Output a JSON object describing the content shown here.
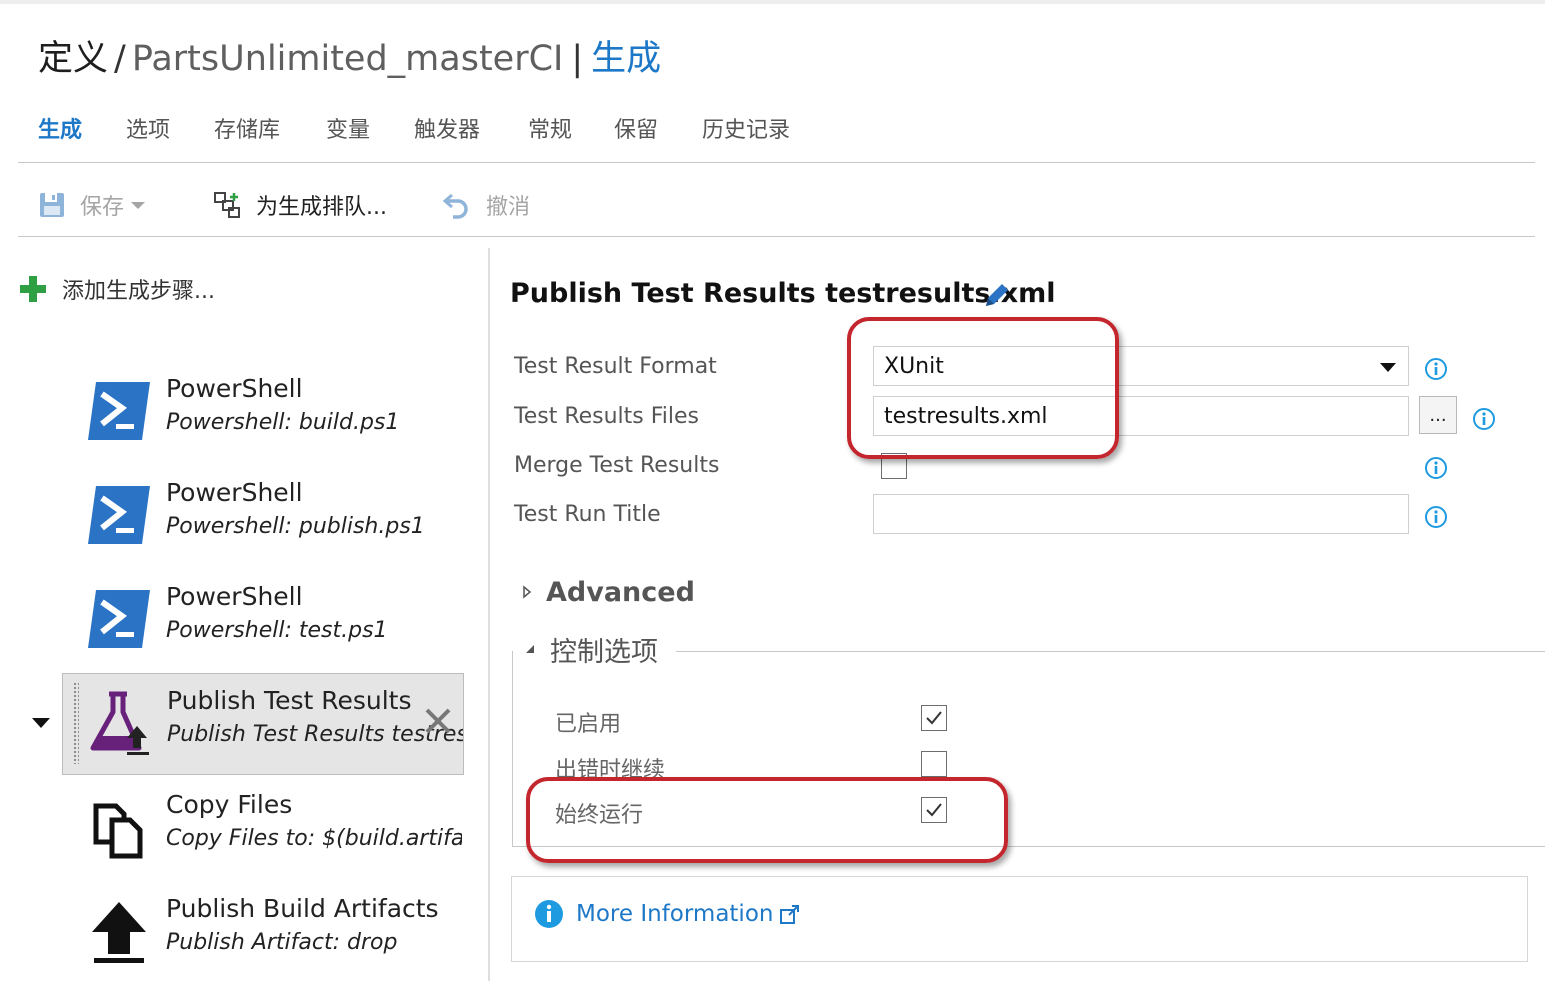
{
  "title": {
    "definition": "定义",
    "separator": "/",
    "definition_name": "PartsUnlimited_masterCI",
    "bar": "|",
    "current": "生成"
  },
  "tabs": [
    {
      "label": "生成",
      "active": true
    },
    {
      "label": "选项"
    },
    {
      "label": "存储库"
    },
    {
      "label": "变量"
    },
    {
      "label": "触发器"
    },
    {
      "label": "常规"
    },
    {
      "label": "保留"
    },
    {
      "label": "历史记录"
    }
  ],
  "toolbar": {
    "save": "保存",
    "queue": "为生成排队...",
    "undo": "撤消"
  },
  "steps_panel": {
    "add_step": "添加生成步骤...",
    "steps": [
      {
        "name": "PowerShell",
        "detail": "Powershell: build.ps1",
        "icon": "powershell-icon"
      },
      {
        "name": "PowerShell",
        "detail": "Powershell: publish.ps1",
        "icon": "powershell-icon"
      },
      {
        "name": "PowerShell",
        "detail": "Powershell: test.ps1",
        "icon": "powershell-icon"
      },
      {
        "name": "Publish Test Results",
        "detail": "Publish Test Results testresul",
        "icon": "flask-upload-icon",
        "selected": true
      },
      {
        "name": "Copy Files",
        "detail": "Copy Files to: $(build.artifact",
        "icon": "copy-files-icon"
      },
      {
        "name": "Publish Build Artifacts",
        "detail": "Publish Artifact: drop",
        "icon": "upload-arrow-icon"
      }
    ]
  },
  "task": {
    "title": "Publish Test Results testresults.xml",
    "fields": {
      "format_label": "Test Result Format",
      "format_value": "XUnit",
      "files_label": "Test Results Files",
      "files_value": "testresults.xml",
      "browse_label": "...",
      "merge_label": "Merge Test Results",
      "merge_checked": false,
      "run_title_label": "Test Run Title",
      "run_title_value": ""
    },
    "advanced_label": "Advanced",
    "control_options": {
      "label": "控制选项",
      "enabled_label": "已启用",
      "enabled_checked": true,
      "continue_on_error_label": "出错时继续",
      "continue_on_error_checked": false,
      "always_run_label": "始终运行",
      "always_run_checked": true
    },
    "more_info": "More Information"
  },
  "colors": {
    "accent": "#1e78c8",
    "callout": "#c4262e",
    "powershell": "#2b73c4",
    "flask": "#68217a"
  }
}
